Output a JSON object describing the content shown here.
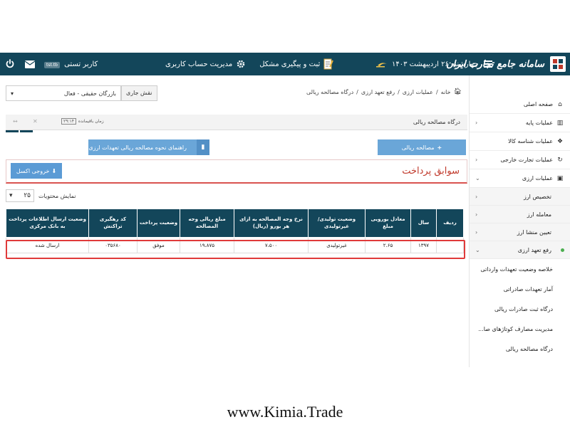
{
  "topbar": {
    "user_badge": "tst.tb",
    "user_label": "کاربر تستی",
    "issue_label": "ثبت و پیگیری مشکل",
    "account_label": "مدیریت حساب کاربری",
    "date_label": "چهارشنبه ۲۶ اردیبهشت ۱۴۰۳",
    "logo_text": "سامانه جامع تجارت ایران",
    "bg_color": "#13465a"
  },
  "role": {
    "label": "نقش جاری",
    "value": "بازرگان حقیقی - فعال"
  },
  "breadcrumb": {
    "items": [
      "خانه",
      "عملیات ارزی",
      "رفع تعهد ارزی",
      "درگاه مصالحه ریالی"
    ]
  },
  "gate": {
    "title": "درگاه مصالحه ریالی",
    "timer_label": "زمان باقیمانده",
    "timer_value": "۲۹:۱۴"
  },
  "buttons": {
    "settlement": "مصالحه ریالی",
    "guide": "راهنمای نحوه مصالحه ریالی تعهدات ارزی",
    "excel": "خروجی اکسل"
  },
  "history": {
    "title": "سوابق پرداخت"
  },
  "page_size": {
    "label": "نمایش محتویات",
    "value": "۲۵"
  },
  "table": {
    "headers": [
      "ردیف",
      "سال",
      "معادل یورویی مبلغ",
      "وضعیت تولیدی/ غیرتولیدی",
      "نرخ وجه المصالحه به ازای هر یورو (ریال)",
      "مبلغ ریالی وجه المصالحه",
      "وضعیت پرداخت",
      "کد رهگیری تراکنش",
      "وضعیت ارسال اطلاعات پرداخت به بانک مرکزی"
    ],
    "rows": [
      [
        "",
        "۱۳۹۷",
        "۲.۶۵",
        "غیرتولیدی",
        "۷،۵۰۰",
        "۱۹،۸۷۵",
        "موفق",
        "۰۳۵۶۸۰",
        "ارسال شده"
      ]
    ]
  },
  "sidebar": {
    "items": [
      {
        "label": "صفحه اصلی",
        "icon": "home-icon"
      },
      {
        "label": "عملیات پایه",
        "icon": "chart-icon"
      },
      {
        "label": "عملیات شناسه کالا",
        "icon": "cubes-icon"
      },
      {
        "label": "عملیات تجارت خارجی",
        "icon": "refresh-icon"
      },
      {
        "label": "عملیات ارزی",
        "icon": "money-icon"
      }
    ],
    "subitems": [
      {
        "label": "تخصیص ارز"
      },
      {
        "label": "معامله ارز"
      },
      {
        "label": "تعیین منشا ارز"
      },
      {
        "label": "رفع تعهد ارزی"
      }
    ],
    "leaves": [
      "خلاصه وضعیت تعهدات وارداتی",
      "آمار تعهدات صادراتی",
      "درگاه ثبت صادرات ریالی",
      "مدیریت مصارف کوتاژهای صا...",
      "درگاه مصالحه ریالی"
    ]
  },
  "footer": {
    "url": "www.Kimia.Trade"
  }
}
